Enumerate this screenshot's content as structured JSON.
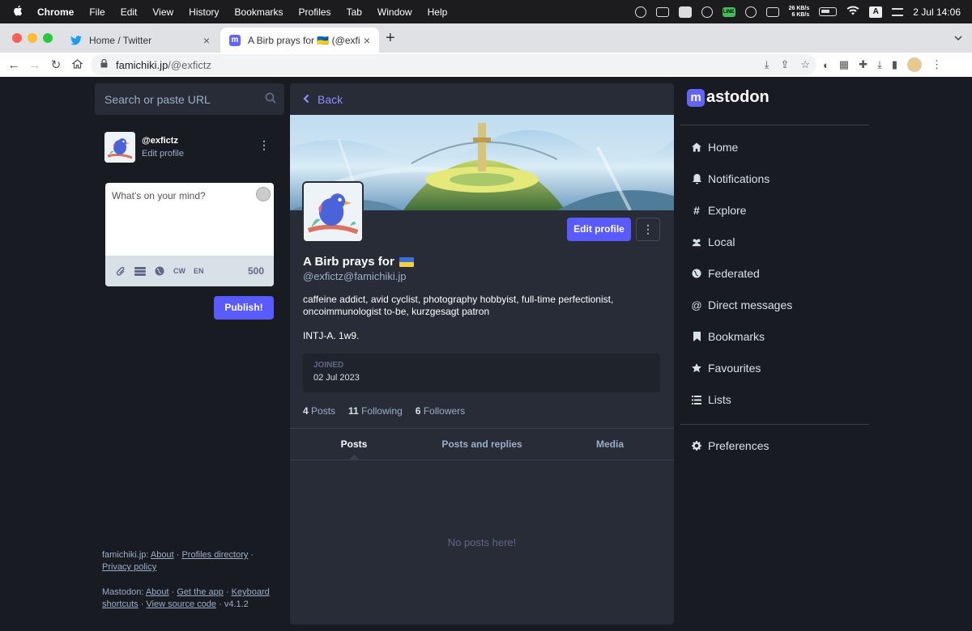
{
  "menubar": {
    "app": "Chrome",
    "items": [
      "File",
      "Edit",
      "View",
      "History",
      "Bookmarks",
      "Profiles",
      "Tab",
      "Window",
      "Help"
    ],
    "net_up": "26 KB/s",
    "net_down": "6 KB/s",
    "input_source": "A",
    "clock": "2 Jul  14:06"
  },
  "browser": {
    "tabs": [
      {
        "title": "Home / Twitter"
      },
      {
        "title": "A Birb prays for 🇺🇦 (@exfictz@"
      }
    ],
    "url_host": "famichiki.jp",
    "url_path": "/@exfictz"
  },
  "left": {
    "search_placeholder": "Search or paste URL",
    "account": {
      "handle": "@exfictz",
      "edit_label": "Edit profile"
    },
    "composer": {
      "placeholder": "What's on your mind?",
      "cw": "CW",
      "lang": "EN",
      "counter": "500"
    },
    "publish_label": "Publish!",
    "footer1": {
      "server": "famichiki.jp",
      "links": [
        "About",
        "Profiles directory",
        "Privacy policy"
      ]
    },
    "footer2": {
      "brand": "Mastodon",
      "links": [
        "About",
        "Get the app",
        "Keyboard shortcuts",
        "View source code"
      ],
      "version": "v4.1.2"
    }
  },
  "profile": {
    "back_label": "Back",
    "display_name": "A Birb prays for",
    "acct": "@exfictz@famichiki.jp",
    "edit_label": "Edit profile",
    "bio_line1": "caffeine addict, avid cyclist, photography hobbyist, full-time perfectionist, oncoimmunologist to-be, kurzgesagt patron",
    "bio_line2": "INTJ-A. 1w9.",
    "joined_label": "JOINED",
    "joined_date": "02 Jul 2023",
    "counts": {
      "posts_num": "4",
      "posts_label": "Posts",
      "following_num": "11",
      "following_label": "Following",
      "followers_num": "6",
      "followers_label": "Followers"
    },
    "tabs": [
      "Posts",
      "Posts and replies",
      "Media"
    ],
    "empty_text": "No posts here!"
  },
  "nav": {
    "logo_text": "astodon",
    "items": [
      {
        "label": "Home",
        "icon": "home-icon"
      },
      {
        "label": "Notifications",
        "icon": "bell-icon"
      },
      {
        "label": "Explore",
        "icon": "hashtag-icon"
      },
      {
        "label": "Local",
        "icon": "users-icon"
      },
      {
        "label": "Federated",
        "icon": "globe-icon"
      },
      {
        "label": "Direct messages",
        "icon": "at-icon"
      },
      {
        "label": "Bookmarks",
        "icon": "bookmark-icon"
      },
      {
        "label": "Favourites",
        "icon": "star-icon"
      },
      {
        "label": "Lists",
        "icon": "list-icon"
      }
    ],
    "preferences": "Preferences"
  },
  "colors": {
    "accent": "#595aff",
    "background": "#191b22",
    "panel": "#282c37",
    "link": "#8c8dff",
    "muted": "#9baec8"
  }
}
